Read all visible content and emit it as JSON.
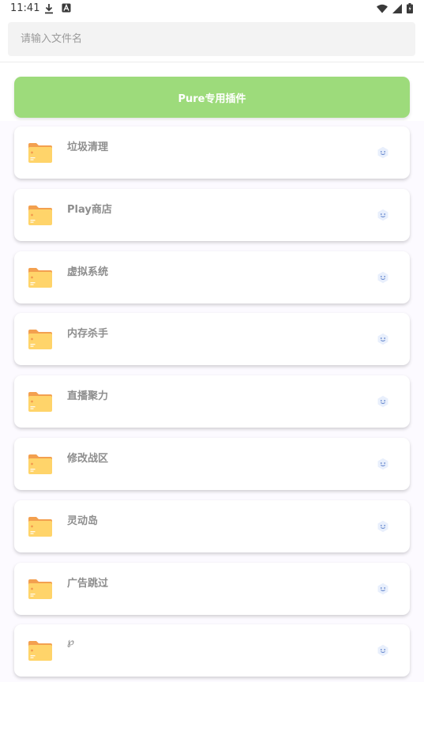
{
  "status_bar": {
    "time": "11:41",
    "left_icons": [
      "download-icon",
      "font-badge-icon"
    ],
    "right_icons": [
      "wifi-icon",
      "signal-icon",
      "battery-icon"
    ]
  },
  "search": {
    "placeholder": "请输入文件名",
    "value": ""
  },
  "primary_button": {
    "label": "Pure专用插件",
    "color": "#9ddb7b"
  },
  "items": [
    {
      "label": "垃圾清理",
      "icon": "folder-icon",
      "action_icon": "smiley-icon"
    },
    {
      "label": "Play商店",
      "icon": "folder-icon",
      "action_icon": "smiley-icon"
    },
    {
      "label": "虚拟系统",
      "icon": "folder-icon",
      "action_icon": "smiley-icon"
    },
    {
      "label": "内存杀手",
      "icon": "folder-icon",
      "action_icon": "smiley-icon"
    },
    {
      "label": "直播聚力",
      "icon": "folder-icon",
      "action_icon": "smiley-icon"
    },
    {
      "label": "修改战区",
      "icon": "folder-icon",
      "action_icon": "smiley-icon"
    },
    {
      "label": "灵动岛",
      "icon": "folder-icon",
      "action_icon": "smiley-icon"
    },
    {
      "label": "广告跳过",
      "icon": "folder-icon",
      "action_icon": "smiley-icon"
    },
    {
      "label": "℘",
      "icon": "folder-icon",
      "action_icon": "smiley-icon"
    }
  ]
}
